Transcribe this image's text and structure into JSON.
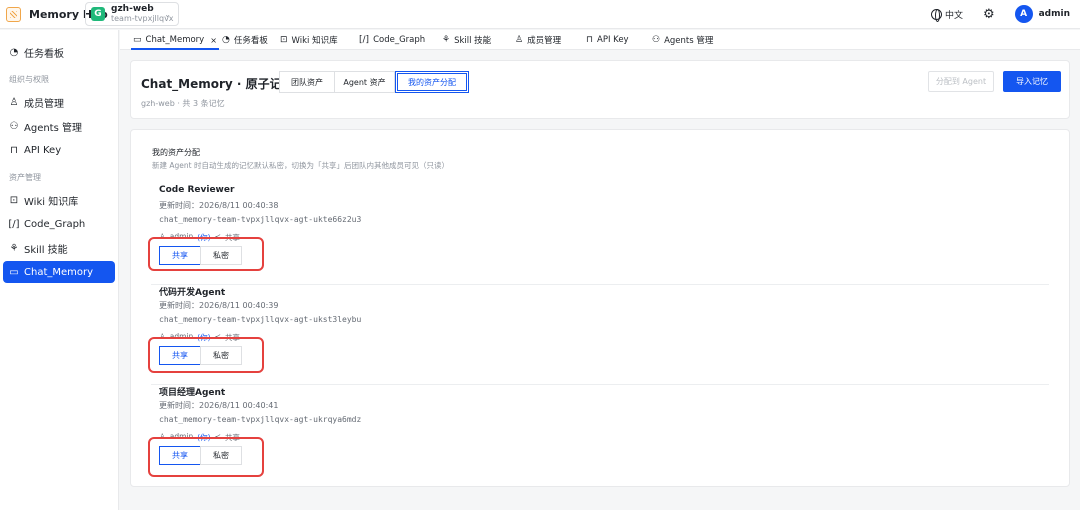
{
  "app": {
    "title": "Memory Hub",
    "team_initial": "G",
    "team_name": "gzh-web",
    "team_id": "team-tvpxjllqvx"
  },
  "topbar": {
    "language": "中文",
    "user_initial": "A",
    "user_name": "admin"
  },
  "sidebar": {
    "dashboard": "任务看板",
    "group_org": "组织与权限",
    "members": "成员管理",
    "agents": "Agents 管理",
    "api_key": "API Key",
    "group_assets": "资产管理",
    "wiki": "Wiki 知识库",
    "code_graph": "Code_Graph",
    "skill": "Skill 技能",
    "chat_memory": "Chat_Memory"
  },
  "tabs": {
    "chat_memory": "Chat_Memory",
    "close": "×",
    "dashboard": "任务看板",
    "wiki": "Wiki 知识库",
    "code_graph": "Code_Graph",
    "skill": "Skill 技能",
    "members": "成员管理",
    "api_key": "API Key",
    "agents": "Agents 管理"
  },
  "header": {
    "title": "Chat_Memory · 原子记忆块",
    "seg_team": "团队资产",
    "seg_agent": "Agent 资产",
    "seg_mine": "我的资产分配",
    "subtitle": "gzh-web · 共 3 条记忆",
    "assign_button": "分配到 Agent",
    "import_button": "导入记忆"
  },
  "section": {
    "title": "我的资产分配",
    "description": "新建 Agent 时自动生成的记忆默认私密，切换为「共享」后团队内其他成员可见（只读）"
  },
  "entries": [
    {
      "name": "Code Reviewer",
      "updated": "更新时间：2026/8/11 00:40:38",
      "id": "chat_memory-team-tvpxjllqvx-agt-ukte66z2u3",
      "owner": "admin",
      "owner_tag": "(你)",
      "share_tag": "共享",
      "share_label": "共享",
      "private_label": "私密"
    },
    {
      "name": "代码开发Agent",
      "updated": "更新时间：2026/8/11 00:40:39",
      "id": "chat_memory-team-tvpxjllqvx-agt-ukst3leybu",
      "owner": "admin",
      "owner_tag": "(你)",
      "share_tag": "共享",
      "share_label": "共享",
      "private_label": "私密"
    },
    {
      "name": "项目经理Agent",
      "updated": "更新时间：2026/8/11 00:40:41",
      "id": "chat_memory-team-tvpxjllqvx-agt-ukrqya6mdz",
      "owner": "admin",
      "owner_tag": "(你)",
      "share_tag": "共享",
      "share_label": "共享",
      "private_label": "私密"
    }
  ],
  "colors": {
    "accent": "#1456f0",
    "highlight": "#e5413e",
    "team_badge": "#1fb87a"
  }
}
